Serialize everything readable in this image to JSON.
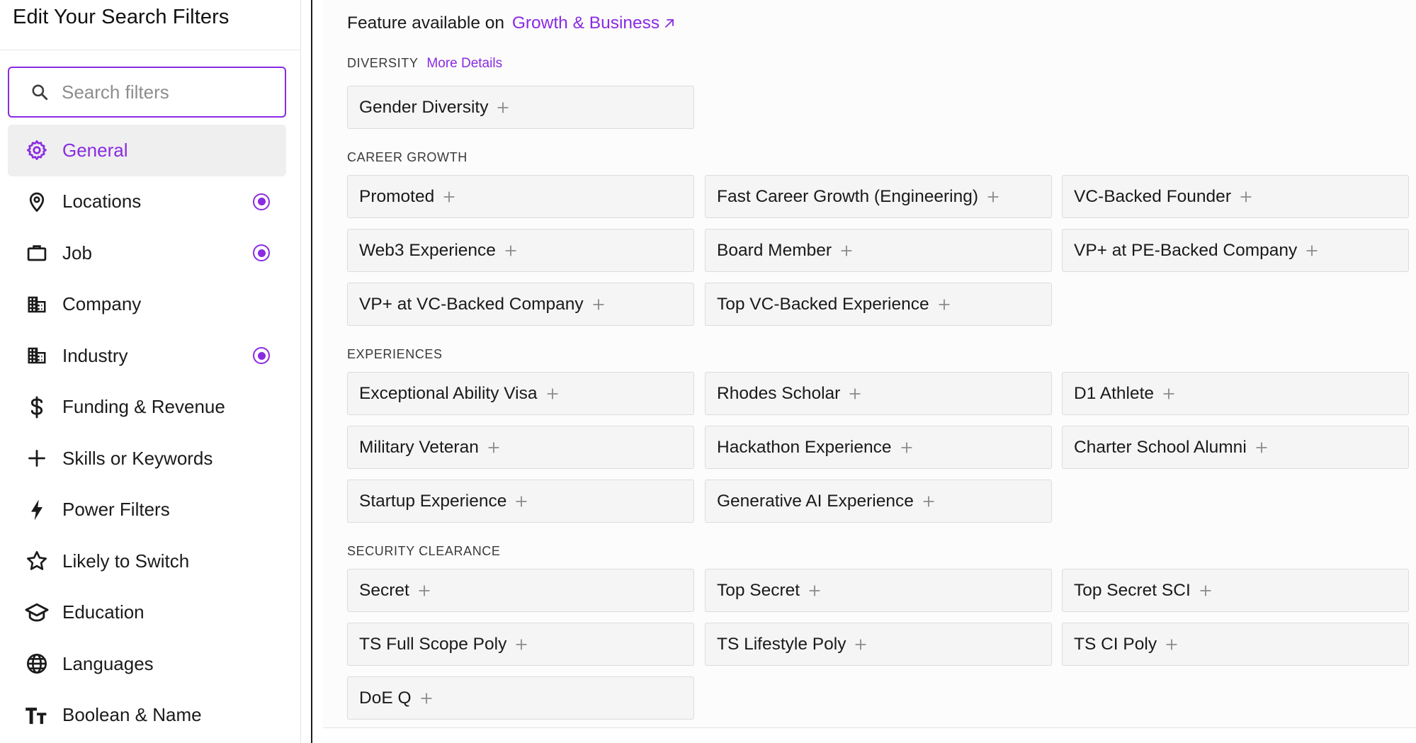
{
  "sidebar": {
    "title": "Edit Your Search Filters",
    "search_placeholder": "Search filters",
    "items": [
      {
        "label": "General",
        "icon": "gear-icon",
        "active": true,
        "badge": false
      },
      {
        "label": "Locations",
        "icon": "location-pin-icon",
        "active": false,
        "badge": true
      },
      {
        "label": "Job",
        "icon": "briefcase-icon",
        "active": false,
        "badge": true
      },
      {
        "label": "Company",
        "icon": "building-icon",
        "active": false,
        "badge": false
      },
      {
        "label": "Industry",
        "icon": "building-icon",
        "active": false,
        "badge": true
      },
      {
        "label": "Funding & Revenue",
        "icon": "dollar-icon",
        "active": false,
        "badge": false
      },
      {
        "label": "Skills or Keywords",
        "icon": "plus-icon",
        "active": false,
        "badge": false
      },
      {
        "label": "Power Filters",
        "icon": "lightning-icon",
        "active": false,
        "badge": false
      },
      {
        "label": "Likely to Switch",
        "icon": "star-icon",
        "active": false,
        "badge": false
      },
      {
        "label": "Education",
        "icon": "graduation-cap-icon",
        "active": false,
        "badge": false
      },
      {
        "label": "Languages",
        "icon": "globe-icon",
        "active": false,
        "badge": false
      },
      {
        "label": "Boolean & Name",
        "icon": "text-size-icon",
        "active": false,
        "badge": false
      }
    ]
  },
  "main": {
    "feature_prefix": "Feature available on",
    "feature_link": "Growth & Business",
    "diversity": {
      "label": "DIVERSITY",
      "more_details": "More Details",
      "chips": [
        "Gender Diversity"
      ]
    },
    "career_growth": {
      "label": "CAREER GROWTH",
      "chips": [
        "Promoted",
        "Fast Career Growth (Engineering)",
        "VC-Backed Founder",
        "Web3 Experience",
        "Board Member",
        "VP+ at PE-Backed Company",
        "VP+ at VC-Backed Company",
        "Top VC-Backed Experience"
      ]
    },
    "experiences": {
      "label": "EXPERIENCES",
      "chips": [
        "Exceptional Ability Visa",
        "Rhodes Scholar",
        "D1 Athlete",
        "Military Veteran",
        "Hackathon Experience",
        "Charter School Alumni",
        "Startup Experience",
        "Generative AI Experience"
      ]
    },
    "security_clearance": {
      "label": "SECURITY CLEARANCE",
      "chips": [
        "Secret",
        "Top Secret",
        "Top Secret SCI",
        "TS Full Scope Poly",
        "TS Lifestyle Poly",
        "TS CI Poly",
        "DoE Q"
      ]
    }
  },
  "colors": {
    "accent": "#8a2be2",
    "chip_bg": "#f5f5f5",
    "chip_border": "#dcdcdc"
  }
}
